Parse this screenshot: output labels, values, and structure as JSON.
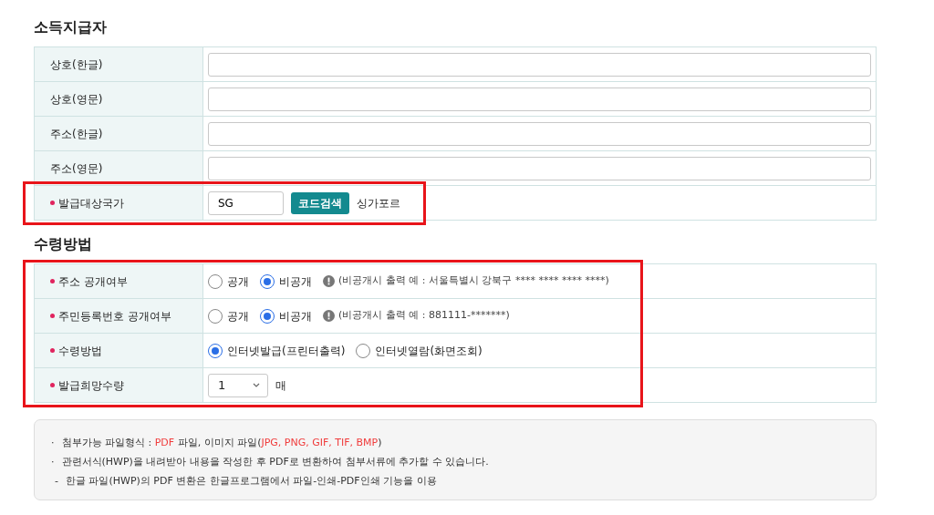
{
  "sections": [
    {
      "title": "소득지급자",
      "highlight": {
        "kind": "last"
      },
      "rows": [
        {
          "kind": "text",
          "label": "상호(한글)",
          "required": false
        },
        {
          "kind": "text",
          "label": "상호(영문)",
          "required": false
        },
        {
          "kind": "text",
          "label": "주소(한글)",
          "required": false
        },
        {
          "kind": "text",
          "label": "주소(영문)",
          "required": false
        },
        {
          "kind": "country",
          "label": "발급대상국가",
          "required": true,
          "value": "SG",
          "button": "코드검색",
          "result": "싱가포르"
        }
      ]
    },
    {
      "title": "수령방법",
      "highlight": {
        "kind": "all"
      },
      "rows": [
        {
          "kind": "radio",
          "label": "주소 공개여부",
          "required": true,
          "options": [
            {
              "label": "공개",
              "selected": false
            },
            {
              "label": "비공개",
              "selected": true
            }
          ],
          "note": "(비공개시 출력 예 : 서울특별시 강북구 **** **** **** ****)"
        },
        {
          "kind": "radio",
          "label": "주민등록번호 공개여부",
          "required": true,
          "options": [
            {
              "label": "공개",
              "selected": false
            },
            {
              "label": "비공개",
              "selected": true
            }
          ],
          "note": "(비공개시 출력 예 : 881111-*******)"
        },
        {
          "kind": "radio",
          "label": "수령방법",
          "required": true,
          "options": [
            {
              "label": "인터넷발급(프린터출력)",
              "selected": true
            },
            {
              "label": "인터넷열람(화면조회)",
              "selected": false
            }
          ]
        },
        {
          "kind": "select",
          "label": "발급희망수량",
          "required": true,
          "value": "1",
          "unit": "매"
        }
      ]
    }
  ],
  "notes": [
    {
      "bullet": "·",
      "parts": [
        {
          "text": "첨부가능 파일형식 : ",
          "accent": false
        },
        {
          "text": "PDF",
          "accent": true
        },
        {
          "text": " 파일, 이미지 파일(",
          "accent": false
        },
        {
          "text": "JPG, PNG, GIF, TIF, BMP",
          "accent": true
        },
        {
          "text": ")",
          "accent": false
        }
      ]
    },
    {
      "bullet": "·",
      "parts": [
        {
          "text": "관련서식(HWP)을 내려받아 내용을 작성한 후 PDF로 변환하여 첨부서류에 추가할 수 있습니다.",
          "accent": false
        }
      ]
    },
    {
      "bullet": "-",
      "parts": [
        {
          "text": "한글 파일(HWP)의 PDF 변환은 한글프로그램에서 파일-인쇄-PDF인쇄 기능을 이용",
          "accent": false
        }
      ]
    }
  ]
}
